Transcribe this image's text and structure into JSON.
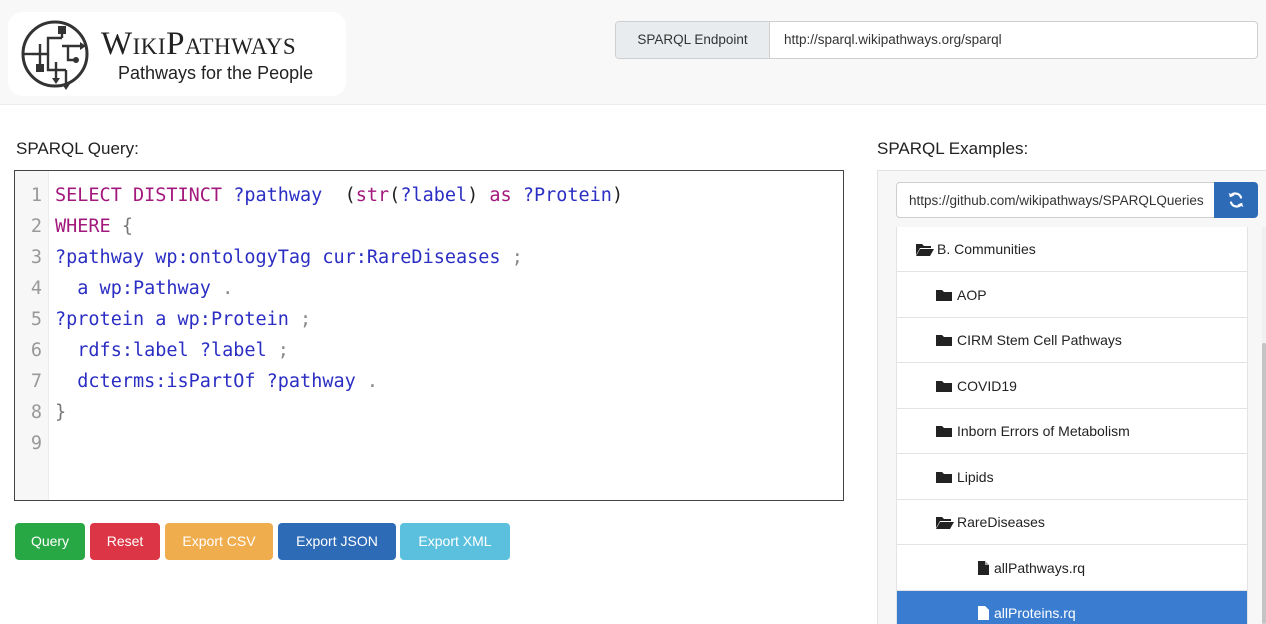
{
  "header": {
    "logo_title": "WikiPathways",
    "logo_subtitle": "Pathways for the People",
    "endpoint_label": "SPARQL Endpoint",
    "endpoint_value": "http://sparql.wikipathways.org/sparql"
  },
  "query": {
    "heading": "SPARQL Query:",
    "lines": [
      {
        "n": "1",
        "tokens": [
          [
            "kw",
            "SELECT DISTINCT "
          ],
          [
            "var",
            "?pathway"
          ],
          [
            "",
            "  ("
          ],
          [
            "kw",
            "str"
          ],
          [
            "",
            "("
          ],
          [
            "var",
            "?label"
          ],
          [
            "",
            ") "
          ],
          [
            "kw",
            "as "
          ],
          [
            "var",
            "?Protein"
          ],
          [
            "",
            ")"
          ]
        ]
      },
      {
        "n": "2",
        "tokens": [
          [
            "kw",
            "WHERE "
          ],
          [
            "brk",
            "{"
          ]
        ]
      },
      {
        "n": "3",
        "tokens": [
          [
            "var",
            "?pathway "
          ],
          [
            "var",
            "wp:ontologyTag "
          ],
          [
            "var",
            "cur:RareDiseases "
          ],
          [
            "pun",
            ";"
          ]
        ]
      },
      {
        "n": "4",
        "tokens": [
          [
            "",
            "  "
          ],
          [
            "var",
            "a wp:Pathway "
          ],
          [
            "pun",
            "."
          ]
        ]
      },
      {
        "n": "5",
        "tokens": [
          [
            "var",
            "?protein "
          ],
          [
            "var",
            "a wp:Protein "
          ],
          [
            "pun",
            ";"
          ]
        ]
      },
      {
        "n": "6",
        "tokens": [
          [
            "",
            "  "
          ],
          [
            "var",
            "rdfs:label "
          ],
          [
            "var",
            "?label "
          ],
          [
            "pun",
            ";"
          ]
        ]
      },
      {
        "n": "7",
        "tokens": [
          [
            "",
            "  "
          ],
          [
            "var",
            "dcterms:isPartOf "
          ],
          [
            "var",
            "?pathway "
          ],
          [
            "pun",
            "."
          ]
        ]
      },
      {
        "n": "8",
        "tokens": [
          [
            "brk",
            "}"
          ]
        ]
      },
      {
        "n": "9",
        "tokens": []
      }
    ]
  },
  "buttons": {
    "query": "Query",
    "reset": "Reset",
    "export_csv": "Export CSV",
    "export_json": "Export JSON",
    "export_xml": "Export XML"
  },
  "examples": {
    "heading": "SPARQL Examples:",
    "repo_value": "https://github.com/wikipathways/SPARQLQueries",
    "tree": [
      {
        "label": "B. Communities",
        "icon": "folder-open-icon",
        "level": 0
      },
      {
        "label": "AOP",
        "icon": "folder-icon",
        "level": 1
      },
      {
        "label": "CIRM Stem Cell Pathways",
        "icon": "folder-icon",
        "level": 1
      },
      {
        "label": "COVID19",
        "icon": "folder-icon",
        "level": 1
      },
      {
        "label": "Inborn Errors of Metabolism",
        "icon": "folder-icon",
        "level": 1
      },
      {
        "label": "Lipids",
        "icon": "folder-icon",
        "level": 1
      },
      {
        "label": "RareDiseases",
        "icon": "folder-open-icon",
        "level": 1
      },
      {
        "label": "allPathways.rq",
        "icon": "file-icon",
        "level": 2
      },
      {
        "label": "allProteins.rq",
        "icon": "file-icon",
        "level": 2,
        "active": true
      }
    ]
  },
  "colors": {
    "keyword": "#a3187d",
    "variable": "#2b2ec3",
    "active_item": "#3a7ccf",
    "query_btn": "#28a745",
    "reset_btn": "#dc3545",
    "csv_btn": "#f0ad4e",
    "json_btn": "#2d6bb7",
    "xml_btn": "#5bc0de"
  }
}
